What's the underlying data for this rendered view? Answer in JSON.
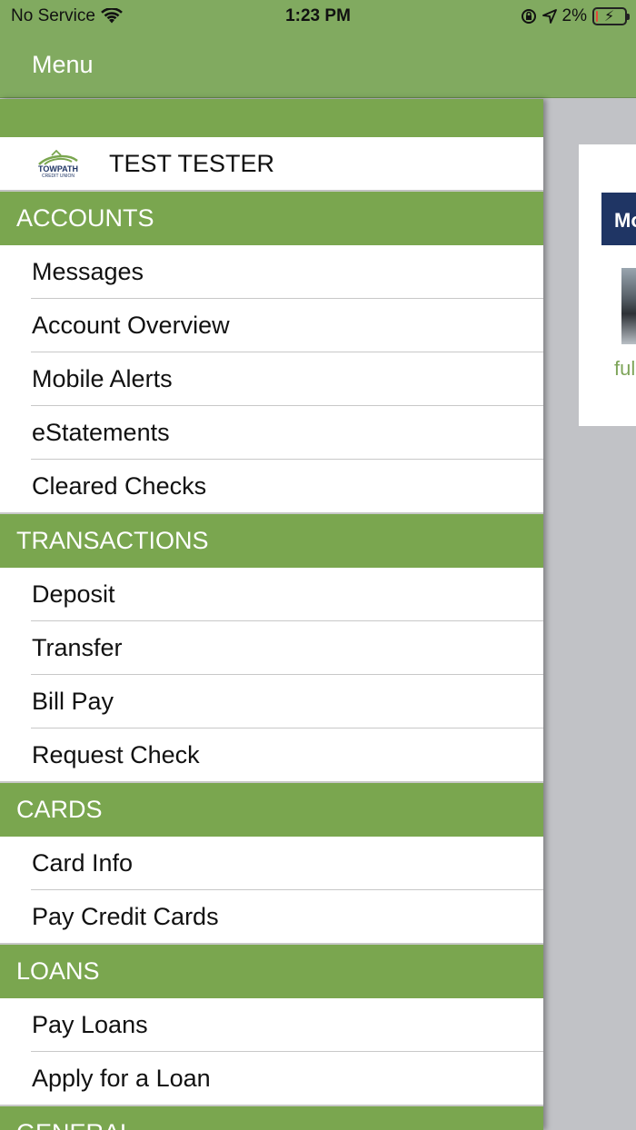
{
  "status_bar": {
    "carrier": "No Service",
    "time": "1:23 PM",
    "battery": "2%",
    "battery_level": 0.02
  },
  "nav": {
    "title": "Menu"
  },
  "profile": {
    "name": "TEST TESTER",
    "logo_text": "TOWPATH",
    "logo_subtext": "CREDIT UNION"
  },
  "sections": [
    {
      "title": "ACCOUNTS",
      "items": [
        "Messages",
        "Account Overview",
        "Mobile Alerts",
        "eStatements",
        "Cleared Checks"
      ]
    },
    {
      "title": "TRANSACTIONS",
      "items": [
        "Deposit",
        "Transfer",
        "Bill Pay",
        "Request Check"
      ]
    },
    {
      "title": "CARDS",
      "items": [
        "Card Info",
        "Pay Credit Cards"
      ]
    },
    {
      "title": "LOANS",
      "items": [
        "Pay Loans",
        "Apply for a Loan"
      ]
    },
    {
      "title": "GENERAL",
      "items": []
    }
  ],
  "background": {
    "card_header": "Mo",
    "card_link": "ful"
  },
  "colors": {
    "nav_green": "#81aa60",
    "section_green": "#7aa64f",
    "card_navy": "#1f3564"
  }
}
